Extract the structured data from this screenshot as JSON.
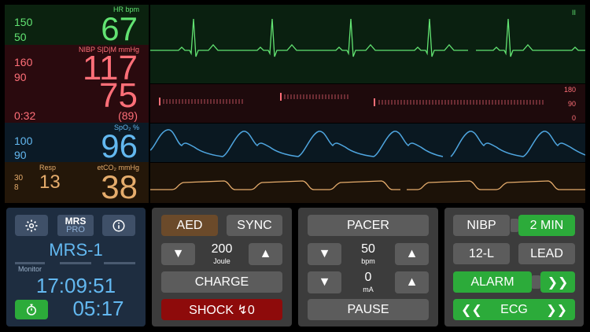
{
  "hr": {
    "label": "HR  bpm",
    "upper": "150",
    "lower": "50",
    "value": "67"
  },
  "nibp": {
    "label": "NIBP S|D|M  mmHg",
    "upper": "160",
    "lower": "90",
    "systolic": "117",
    "diastolic": "75",
    "mean": "(89)",
    "time": "0:32"
  },
  "spo2": {
    "label": "SpO₂  %",
    "upper": "100",
    "lower": "90",
    "value": "96"
  },
  "resp": {
    "label": "Resp",
    "upper": "30",
    "lower": "8",
    "value": "13"
  },
  "etco2": {
    "label": "etCO₂  mmHg",
    "value": "38"
  },
  "ecg_wave": {
    "marker": "II"
  },
  "bp_wave": {
    "scale": [
      "180",
      "90",
      "0"
    ]
  },
  "device": {
    "logo_top": "MRS",
    "logo_bottom": "PRO",
    "name": "MRS-1",
    "mode": "Monitor",
    "clock": "17:09:51",
    "timer": "05:17"
  },
  "defib": {
    "aed_label": "AED",
    "sync_label": "SYNC",
    "energy_value": "200",
    "energy_unit": "Joule",
    "charge_label": "CHARGE",
    "shock_label": "SHOCK ↯0"
  },
  "pacer": {
    "pacer_label": "PACER",
    "rate_value": "50",
    "rate_unit": "bpm",
    "current_value": "0",
    "current_unit": "mA",
    "pause_label": "PAUSE"
  },
  "controls": {
    "nibp_label": "NIBP",
    "interval_label": "2 MIN",
    "lead12_label": "12-L",
    "lead_label": "LEAD",
    "alarm_label": "ALARM",
    "ecg_label": "ECG"
  },
  "colors": {
    "hr": "#62e372",
    "nibp": "#ff6f78",
    "spo2": "#63b8f0",
    "resp": "#e5ac6c",
    "active": "#2cab3a",
    "shock": "#8e0b0b",
    "aed": "#6b4a2a"
  }
}
